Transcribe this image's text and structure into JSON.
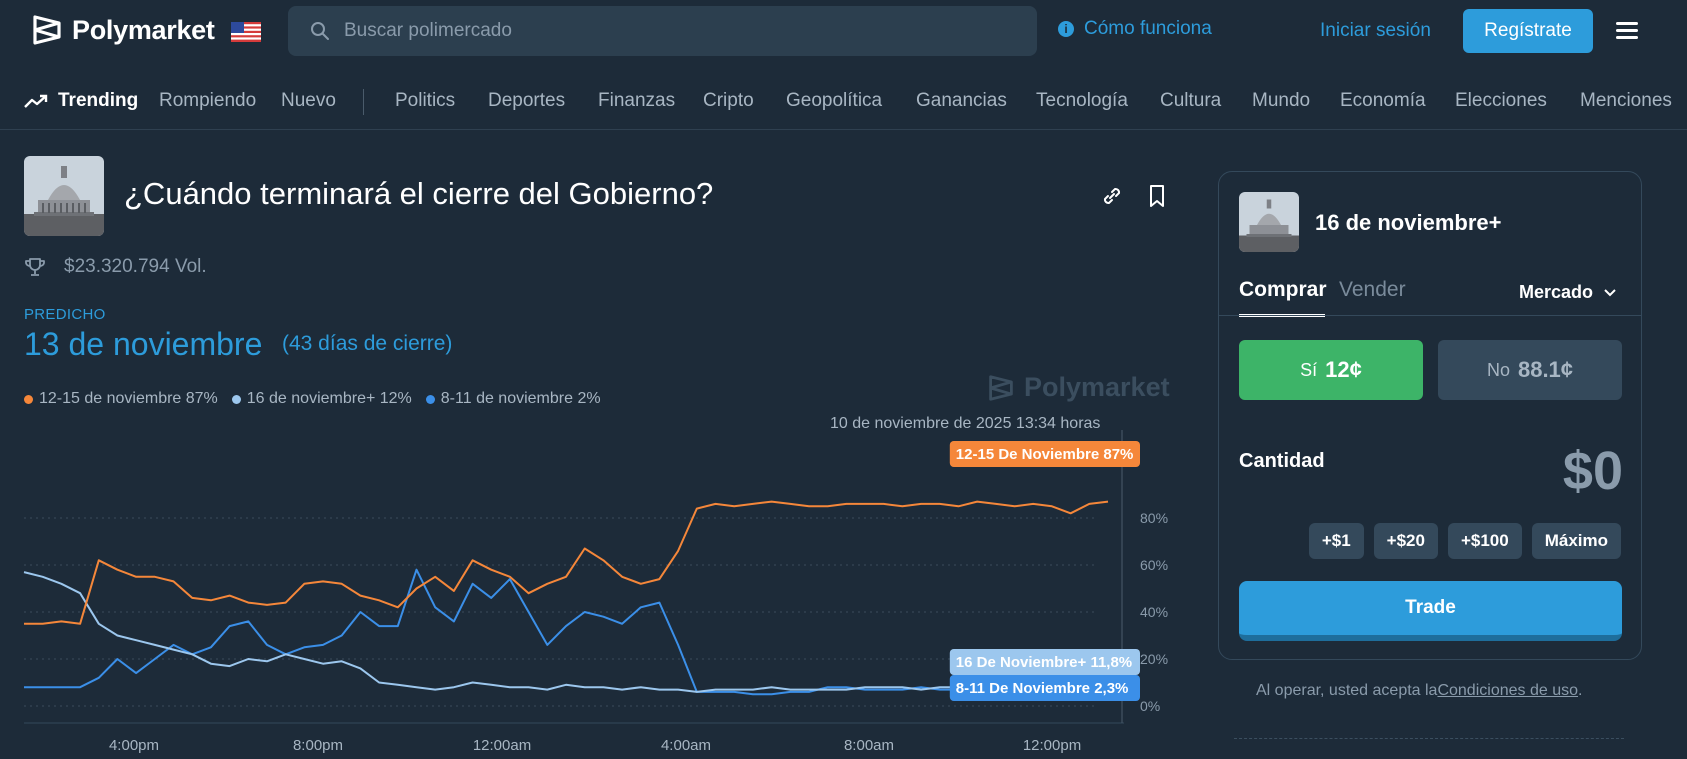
{
  "header": {
    "brand": "Polymarket",
    "search_placeholder": "Buscar polimercado",
    "how_it_works": "Cómo funciona",
    "login": "Iniciar sesión",
    "signup": "Regístrate"
  },
  "nav": {
    "trending": "Trending",
    "items": [
      "Rompiendo",
      "Nuevo",
      "Politics",
      "Deportes",
      "Finanzas",
      "Cripto",
      "Geopolítica",
      "Ganancias",
      "Tecnología",
      "Cultura",
      "Mundo",
      "Economía",
      "Elecciones",
      "Menciones"
    ]
  },
  "market": {
    "title": "¿Cuándo terminará el cierre del Gobierno?",
    "volume": "$23.320.794 Vol.",
    "predicted_label": "PREDICHO",
    "predicted_value": "13 de noviembre",
    "predicted_sub": "(43 días de cierre)",
    "watermark": "Polymarket"
  },
  "legend": [
    {
      "label": "12-15 de noviembre 87%",
      "color": "#f5873a"
    },
    {
      "label": "16 de noviembre+ 12%",
      "color": "#9cc7ee"
    },
    {
      "label": "8-11 de noviembre 2%",
      "color": "#3b8fe8"
    }
  ],
  "chart_data": {
    "type": "line",
    "timestamp": "10 de noviembre de 2025 13:34 horas",
    "x_tick_labels": [
      "4:00pm",
      "8:00pm",
      "12:00am",
      "4:00am",
      "8:00am",
      "12:00pm"
    ],
    "y_tick_labels": [
      "80%",
      "60%",
      "40%",
      "20%",
      "0%"
    ],
    "ylim": [
      0,
      100
    ],
    "series": [
      {
        "name": "12-15 De Noviembre",
        "end_label": "12-15 De Noviembre 87%",
        "color": "#f5873a",
        "values": [
          35,
          35,
          36,
          35,
          62,
          58,
          55,
          55,
          53,
          46,
          45,
          47,
          44,
          43,
          44,
          52,
          53,
          52,
          47,
          45,
          42,
          50,
          55,
          49,
          62,
          58,
          55,
          48,
          52,
          55,
          67,
          62,
          55,
          52,
          54,
          66,
          84,
          86,
          85,
          86,
          87,
          86,
          85,
          85,
          86,
          86,
          86,
          85,
          86,
          86,
          85,
          87,
          86,
          85,
          86,
          85,
          82,
          86,
          87
        ]
      },
      {
        "name": "16 De Noviembre+",
        "end_label": "16 De Noviembre+ 11,8%",
        "color": "#9cc7ee",
        "values": [
          57,
          55,
          52,
          48,
          35,
          30,
          28,
          26,
          24,
          22,
          18,
          17,
          20,
          19,
          22,
          20,
          18,
          19,
          16,
          10,
          9,
          8,
          7,
          8,
          10,
          9,
          8,
          8,
          7,
          9,
          8,
          8,
          7,
          8,
          7,
          7,
          6,
          7,
          7,
          7,
          8,
          7,
          7,
          7,
          7,
          8,
          8,
          8,
          7,
          8,
          8,
          8,
          8,
          8,
          8,
          8,
          12,
          12,
          12
        ]
      },
      {
        "name": "8-11 De Noviembre",
        "end_label": "8-11 De Noviembre 2,3%",
        "color": "#3b8fe8",
        "values": [
          8,
          8,
          8,
          8,
          12,
          20,
          14,
          20,
          26,
          22,
          25,
          34,
          36,
          26,
          22,
          25,
          26,
          30,
          40,
          34,
          34,
          58,
          42,
          36,
          52,
          46,
          54,
          40,
          26,
          34,
          40,
          38,
          35,
          42,
          44,
          26,
          6,
          6,
          6,
          5,
          5,
          6,
          6,
          8,
          8,
          7,
          7,
          7,
          8,
          7,
          7,
          7,
          7,
          7,
          7,
          7,
          7,
          7,
          8
        ]
      }
    ]
  },
  "trade_panel": {
    "outcome": "16 de noviembre+",
    "tab_buy": "Comprar",
    "tab_sell": "Vender",
    "order_type": "Mercado",
    "yes_label": "Sí",
    "yes_price": "12¢",
    "no_label": "No",
    "no_price": "88.1¢",
    "amount_label": "Cantidad",
    "amount_value": "$0",
    "chips": [
      "+$1",
      "+$20",
      "+$100",
      "Máximo"
    ],
    "trade_button": "Trade",
    "terms_prefix": "Al operar, usted acepta la",
    "terms_link": "Condiciones de uso",
    "terms_suffix": "."
  }
}
